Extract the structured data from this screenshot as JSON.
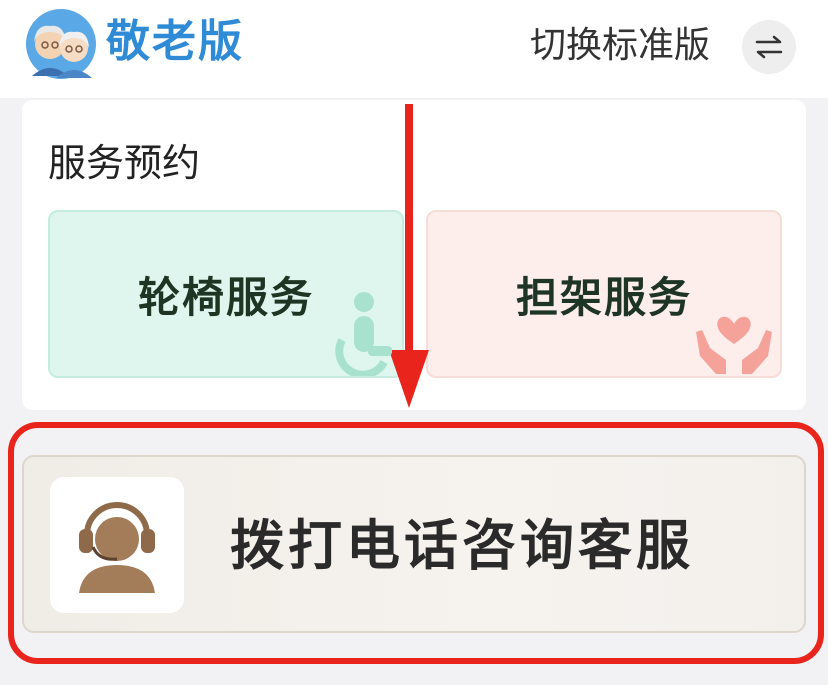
{
  "header": {
    "brand_title": "敬老版",
    "switch_label": "切换标准版"
  },
  "service_section": {
    "title": "服务预约",
    "tiles": [
      {
        "label": "轮椅服务",
        "icon": "wheelchair-icon"
      },
      {
        "label": "担架服务",
        "icon": "heart-hands-icon"
      }
    ]
  },
  "call_service": {
    "label": "拨打电话咨询客服",
    "icon": "headset-agent-icon"
  },
  "colors": {
    "brand": "#2f8bd6",
    "highlight": "#e8241c",
    "wheelchair_tile": "#dff6ef",
    "stretcher_tile": "#fdeeec"
  }
}
